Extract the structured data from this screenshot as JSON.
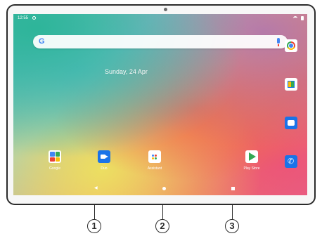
{
  "status_bar": {
    "time": "12:55"
  },
  "search": {
    "logo": "G"
  },
  "home": {
    "date": "Sunday, 24 Apr"
  },
  "dock": [
    {
      "name": "chrome",
      "icon": "chrome-icon"
    },
    {
      "name": "photos",
      "icon": "photos-icon"
    },
    {
      "name": "messages",
      "icon": "messages-icon"
    },
    {
      "name": "phone",
      "icon": "phone-icon",
      "glyph": "✆"
    }
  ],
  "apps": [
    {
      "label": "Google",
      "icon": "google-folder-icon"
    },
    {
      "label": "Duo",
      "icon": "duo-icon"
    },
    {
      "label": "Assistant",
      "icon": "assistant-icon"
    },
    {
      "label": "Play Store",
      "icon": "play-store-icon"
    }
  ],
  "nav": {
    "back_glyph": "◀"
  },
  "callouts": [
    "1",
    "2",
    "3"
  ],
  "colors": {
    "frame": "#2b2b2b",
    "google_blue": "#4285f4",
    "google_red": "#ea4335",
    "google_yellow": "#fbbc05",
    "google_green": "#34a853",
    "app_blue": "#1a73e8"
  }
}
